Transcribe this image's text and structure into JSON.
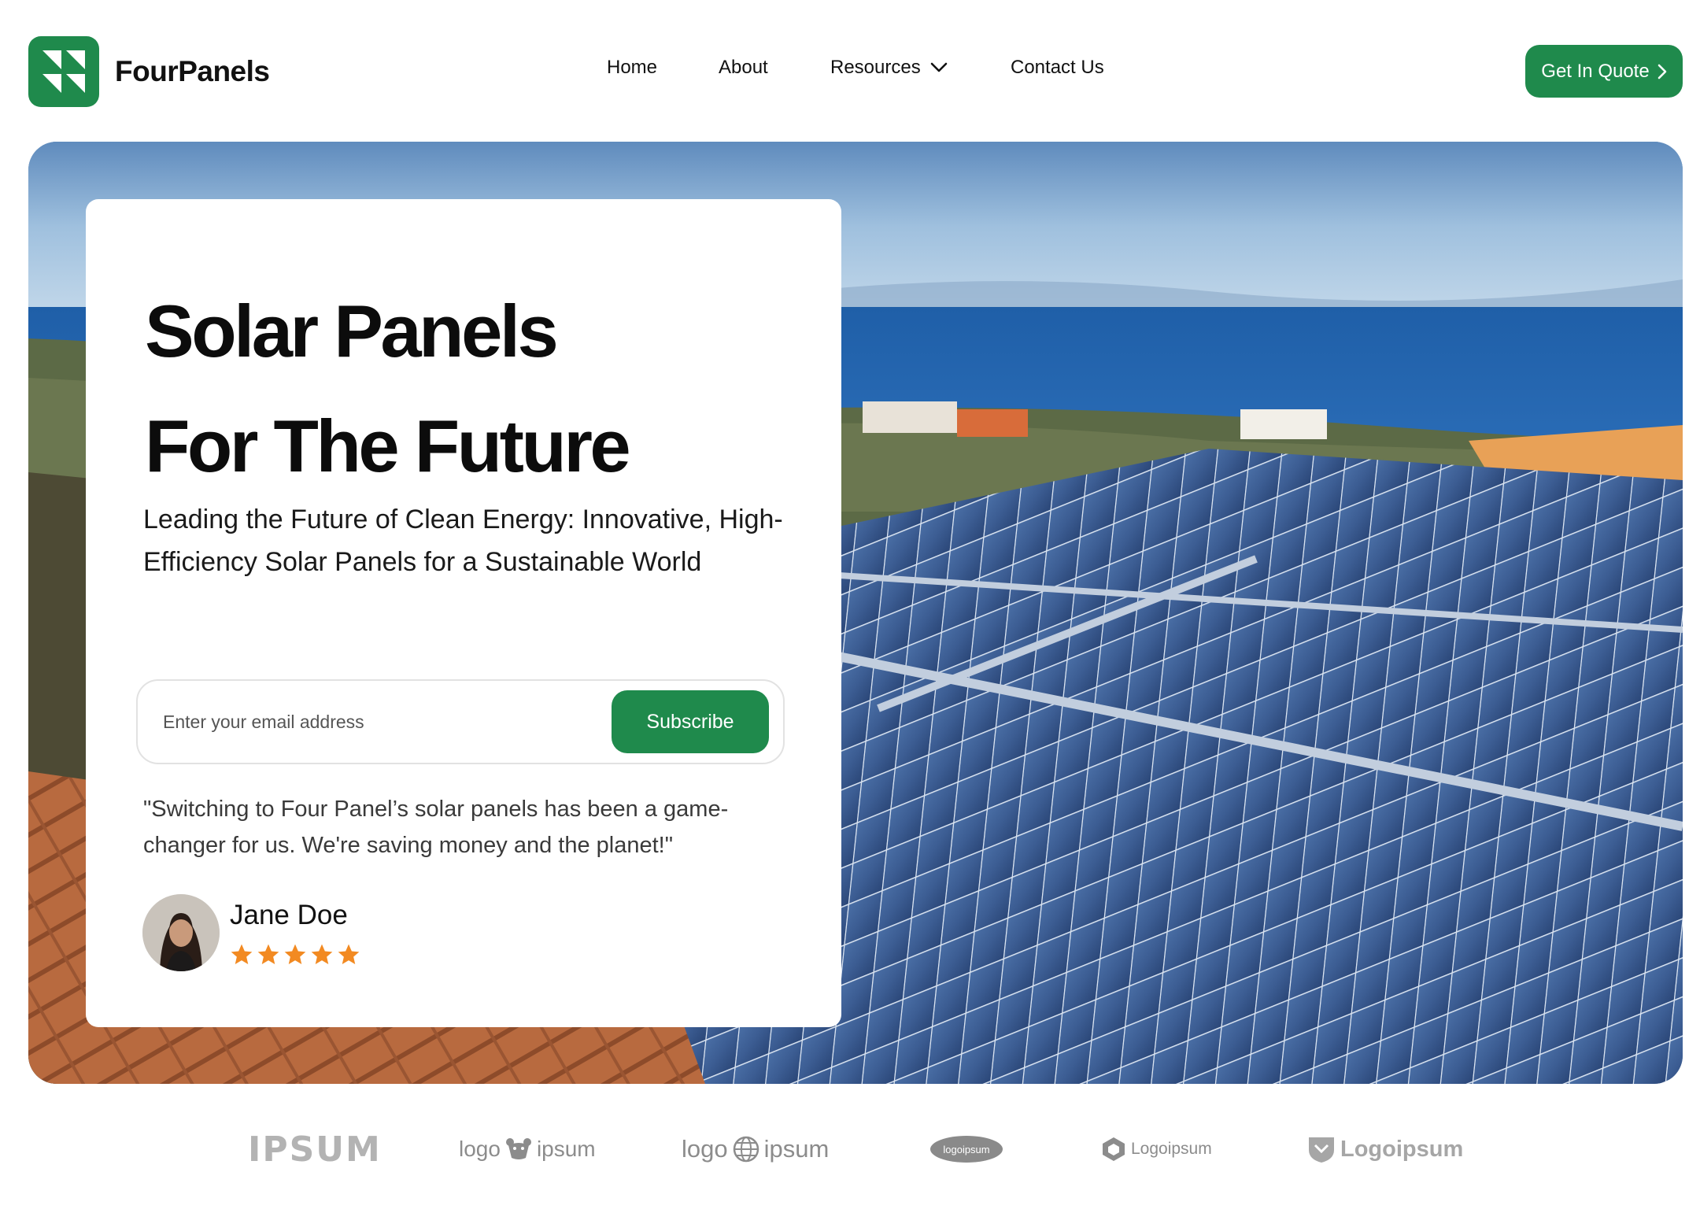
{
  "brand": {
    "name": "FourPanels",
    "color": "#1f8a4c"
  },
  "nav": {
    "items": [
      "Home",
      "About",
      "Resources",
      "Contact Us"
    ]
  },
  "header": {
    "cta_label": "Get In Quote"
  },
  "hero": {
    "title_line1": "Solar Panels",
    "title_line2": "For The Future",
    "subtitle": "Leading the Future of Clean Energy: Innovative, High-Efficiency Solar Panels for a Sustainable World",
    "email_placeholder": "Enter your email address",
    "subscribe_label": "Subscribe",
    "testimonial": "\"Switching to Four Panel’s solar panels has been a game-changer for us. We're saving money and the planet!\"",
    "reviewer_name": "Jane Doe",
    "rating": 5,
    "star_color": "#f28a22"
  },
  "partners": {
    "logos": [
      "IPSUM",
      "logo",
      "ipsum",
      "logo",
      "ipsum",
      "logoipsum",
      "Logoipsum",
      "Logoipsum"
    ]
  }
}
